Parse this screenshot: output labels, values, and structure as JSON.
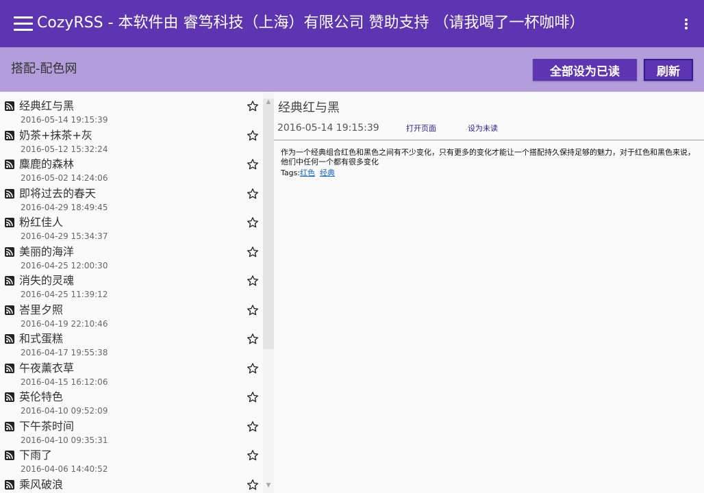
{
  "titlebar": {
    "title": "CozyRSS - 本软件由 睿笃科技（上海）有限公司 赞助支持 （请我喝了一杯咖啡）",
    "menu_icon": "hamburger-menu-icon",
    "more_icon": "more-vertical-icon"
  },
  "feed": {
    "name": "搭配-配色网",
    "mark_all_read_label": "全部设为已读",
    "refresh_label": "刷新"
  },
  "items": [
    {
      "title": "经典红与黑",
      "date": "2016-05-14 19:15:39"
    },
    {
      "title": "奶茶+抹茶+灰",
      "date": "2016-05-12 15:32:24"
    },
    {
      "title": "麋鹿的森林",
      "date": "2016-05-02 14:24:06"
    },
    {
      "title": "即将过去的春天",
      "date": "2016-04-29 18:49:45"
    },
    {
      "title": "粉红佳人",
      "date": "2016-04-29 15:34:37"
    },
    {
      "title": "美丽的海洋",
      "date": "2016-04-25 12:00:30"
    },
    {
      "title": "消失的灵魂",
      "date": "2016-04-25 11:39:12"
    },
    {
      "title": "峇里夕照",
      "date": "2016-04-19 22:10:46"
    },
    {
      "title": "和式蛋糕",
      "date": "2016-04-17 19:55:38"
    },
    {
      "title": "午夜薰衣草",
      "date": "2016-04-15 16:12:06"
    },
    {
      "title": "英伦特色",
      "date": "2016-04-10 09:52:09"
    },
    {
      "title": "下午茶时间",
      "date": "2016-04-10 09:35:31"
    },
    {
      "title": "下雨了",
      "date": "2016-04-06 14:40:52"
    },
    {
      "title": "乘风破浪",
      "date": ""
    }
  ],
  "article": {
    "title": "经典红与黑",
    "date": "2016-05-14 19:15:39",
    "open_page_label": "打开页面",
    "mark_unread_label": "设为未读",
    "body": "作为一个经典组合红色和黑色之间有不少变化，只有更多的变化才能让一个搭配持久保持足够的魅力，对于红色和黑色来说，他们中任何一个都有很多变化",
    "tags_label": "Tags:",
    "tags": [
      "红色",
      "经典"
    ]
  },
  "colors": {
    "primary": "#5e35b1",
    "primary_light": "#b39ddb",
    "primary_dark": "#311b92"
  }
}
